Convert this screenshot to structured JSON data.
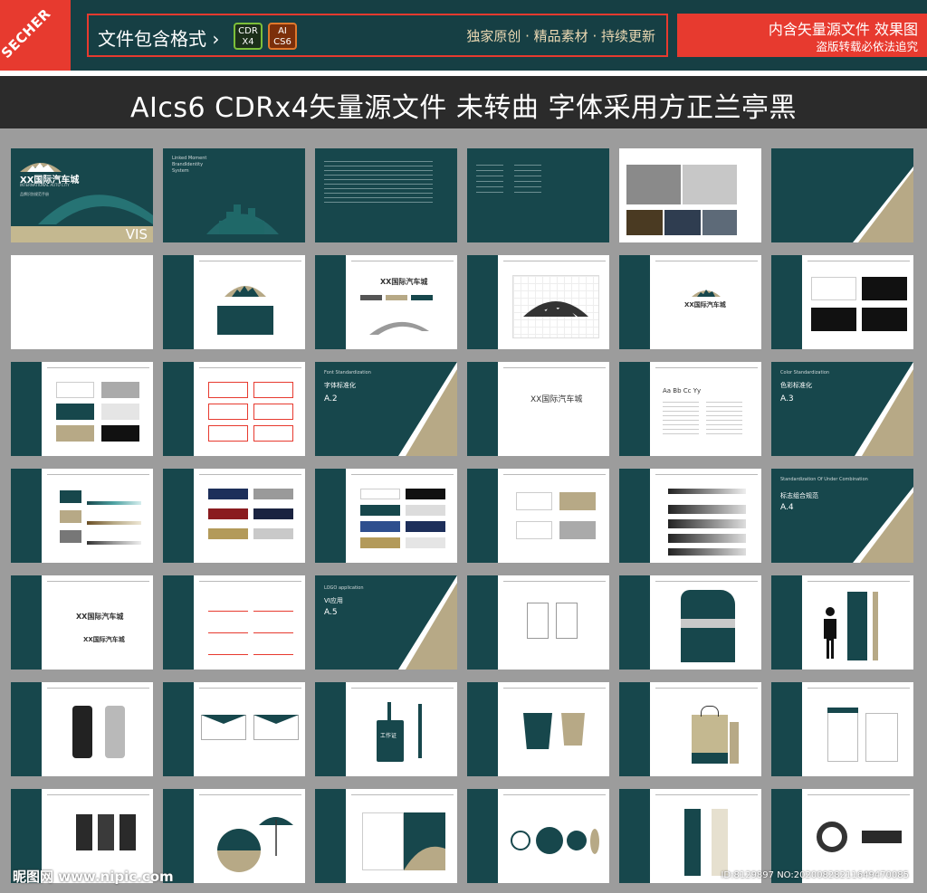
{
  "banner": {
    "corner_brand": "SECHER",
    "format_label": "文件包含格式 ›",
    "chip_cdr": [
      "CDR",
      "X4"
    ],
    "chip_ai": [
      "AI",
      "CS6"
    ],
    "slogan": "独家原创 · 精品素材 · 持续更新",
    "right_line1": "内含矢量源文件 效果图",
    "right_line2": "盗版转载必依法追究"
  },
  "headline": "AIcs6  CDRx4矢量源文件  未转曲  字体采用方正兰亭黑",
  "cover": {
    "logo_name": "XX国际汽车城",
    "logo_en": "INTERNATIONAL AUTO CITY",
    "subtitle": "品牌识别规范手册",
    "vis": "VIS"
  },
  "page2": {
    "lines": [
      "Linked Moment",
      "BrandIdentity",
      "System"
    ]
  },
  "sections": {
    "a2_en": "Font Standardization",
    "a2_cn": "字体标准化",
    "a2_code": "A.2",
    "a3_en": "Color Standardization",
    "a3_cn": "色彩标准化",
    "a3_code": "A.3",
    "a4_en": "Standardization Of Under Combination",
    "a4_cn": "标志组合规范",
    "a4_code": "A.4",
    "a5_en": "LOGO application",
    "a5_cn": "VI应用",
    "a5_code": "A.5"
  },
  "font_sample": "Aa Bb Cc Yy",
  "badge_text": "工作证",
  "colors": {
    "teal": "#17474c",
    "gold": "#b7a986",
    "red": "#e73a2f",
    "navy": "#1d2f5a",
    "maroon": "#8a1b1f"
  },
  "watermark": {
    "left": "昵图网 www.nipic.com",
    "right": "ID:8129897 NO:20200828211649470085"
  }
}
